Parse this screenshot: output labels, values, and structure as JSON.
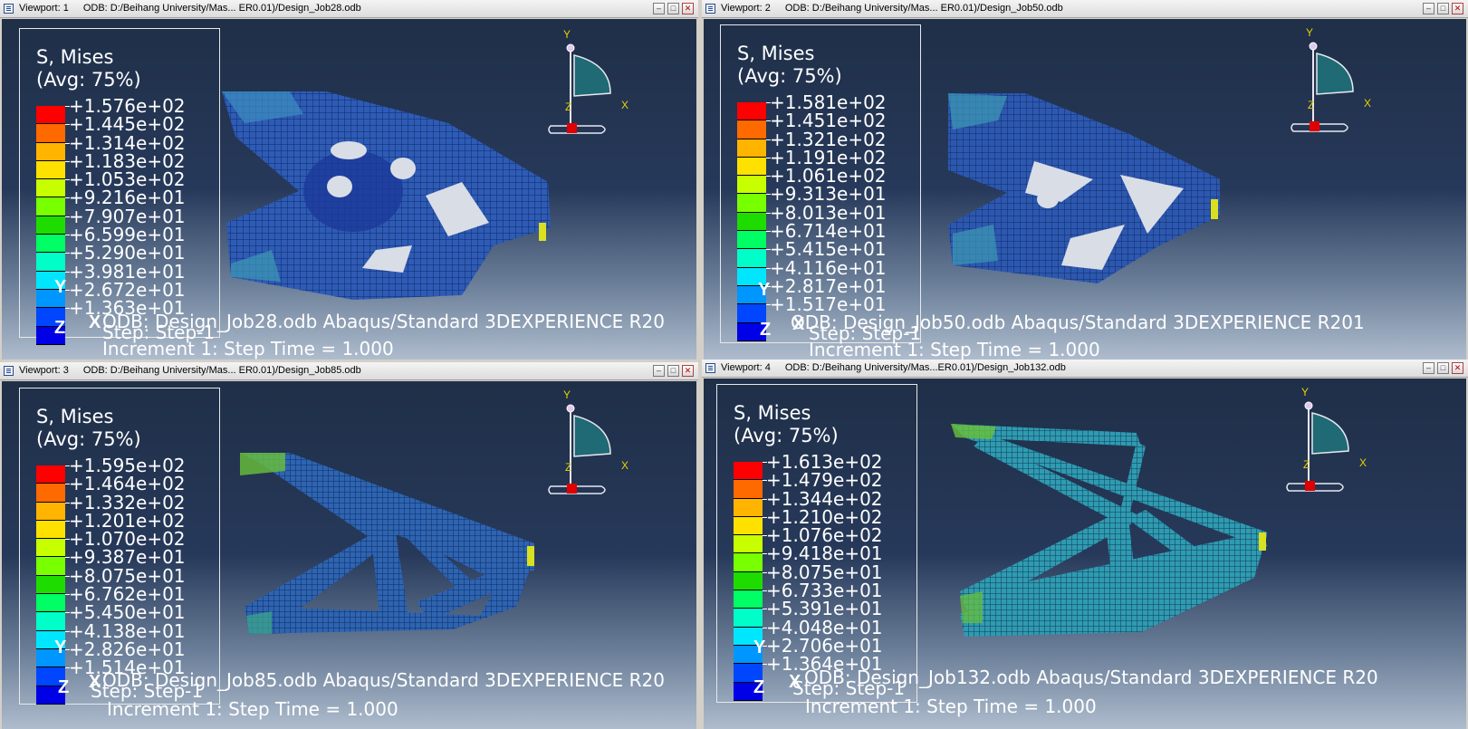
{
  "viewports": [
    {
      "title": "Viewport: 1",
      "odb_path": "ODB: D:/Beihang University/Mas... ER0.01)/Design_Job28.odb",
      "legend_title": "S, Mises",
      "legend_avg": "(Avg: 75%)",
      "values": [
        "+1.576e+02",
        "+1.445e+02",
        "+1.314e+02",
        "+1.183e+02",
        "+1.053e+02",
        "+9.216e+01",
        "+7.907e+01",
        "+6.599e+01",
        "+5.290e+01",
        "+3.981e+01",
        "+2.672e+01",
        "+1.363e+01"
      ],
      "odb_line": "ODB: Design_Job28.odb    Abaqus/Standard 3DEXPERIENCE R20",
      "step_line": "Step: Step-1",
      "increment_line": "Increment     1: Step Time =    1.000"
    },
    {
      "title": "Viewport: 2",
      "odb_path": "ODB: D:/Beihang University/Mas... ER0.01)/Design_Job50.odb",
      "legend_title": "S, Mises",
      "legend_avg": "(Avg: 75%)",
      "values": [
        "+1.581e+02",
        "+1.451e+02",
        "+1.321e+02",
        "+1.191e+02",
        "+1.061e+02",
        "+9.313e+01",
        "+8.013e+01",
        "+6.714e+01",
        "+5.415e+01",
        "+4.116e+01",
        "+2.817e+01",
        "+1.517e+01"
      ],
      "odb_line": "ODB: Design_Job50.odb    Abaqus/Standard 3DEXPERIENCE R201",
      "step_line": "Step: Step-1",
      "increment_line": "Increment     1: Step Time =    1.000"
    },
    {
      "title": "Viewport: 3",
      "odb_path": "ODB: D:/Beihang University/Mas... ER0.01)/Design_Job85.odb",
      "legend_title": "S, Mises",
      "legend_avg": "(Avg: 75%)",
      "values": [
        "+1.595e+02",
        "+1.464e+02",
        "+1.332e+02",
        "+1.201e+02",
        "+1.070e+02",
        "+9.387e+01",
        "+8.075e+01",
        "+6.762e+01",
        "+5.450e+01",
        "+4.138e+01",
        "+2.826e+01",
        "+1.514e+01"
      ],
      "odb_line": "ODB: Design_Job85.odb    Abaqus/Standard 3DEXPERIENCE R20",
      "step_line": "Step: Step-1",
      "increment_line": "Increment     1: Step Time =    1.000"
    },
    {
      "title": "Viewport: 4",
      "odb_path": "ODB: D:/Beihang University/Mas...ER0.01)/Design_Job132.odb",
      "legend_title": "S, Mises",
      "legend_avg": "(Avg: 75%)",
      "values": [
        "+1.613e+02",
        "+1.479e+02",
        "+1.344e+02",
        "+1.210e+02",
        "+1.076e+02",
        "+9.418e+01",
        "+8.075e+01",
        "+6.733e+01",
        "+5.391e+01",
        "+4.048e+01",
        "+2.706e+01",
        "+1.364e+01"
      ],
      "odb_line": "ODB: Design_Job132.odb    Abaqus/Standard 3DEXPERIENCE R20",
      "step_line": "Step: Step-1",
      "increment_line": "Increment     1: Step Time =    1.000"
    }
  ],
  "axis_labels": {
    "x": "X",
    "y": "Y",
    "z": "Z"
  },
  "legend_colors": [
    "#ff0000",
    "#ff6a00",
    "#ffb400",
    "#ffe100",
    "#c8ff00",
    "#78ff00",
    "#1edc00",
    "#00ff64",
    "#00ffc8",
    "#00e6ff",
    "#0096ff",
    "#0046ff",
    "#0000e6"
  ]
}
